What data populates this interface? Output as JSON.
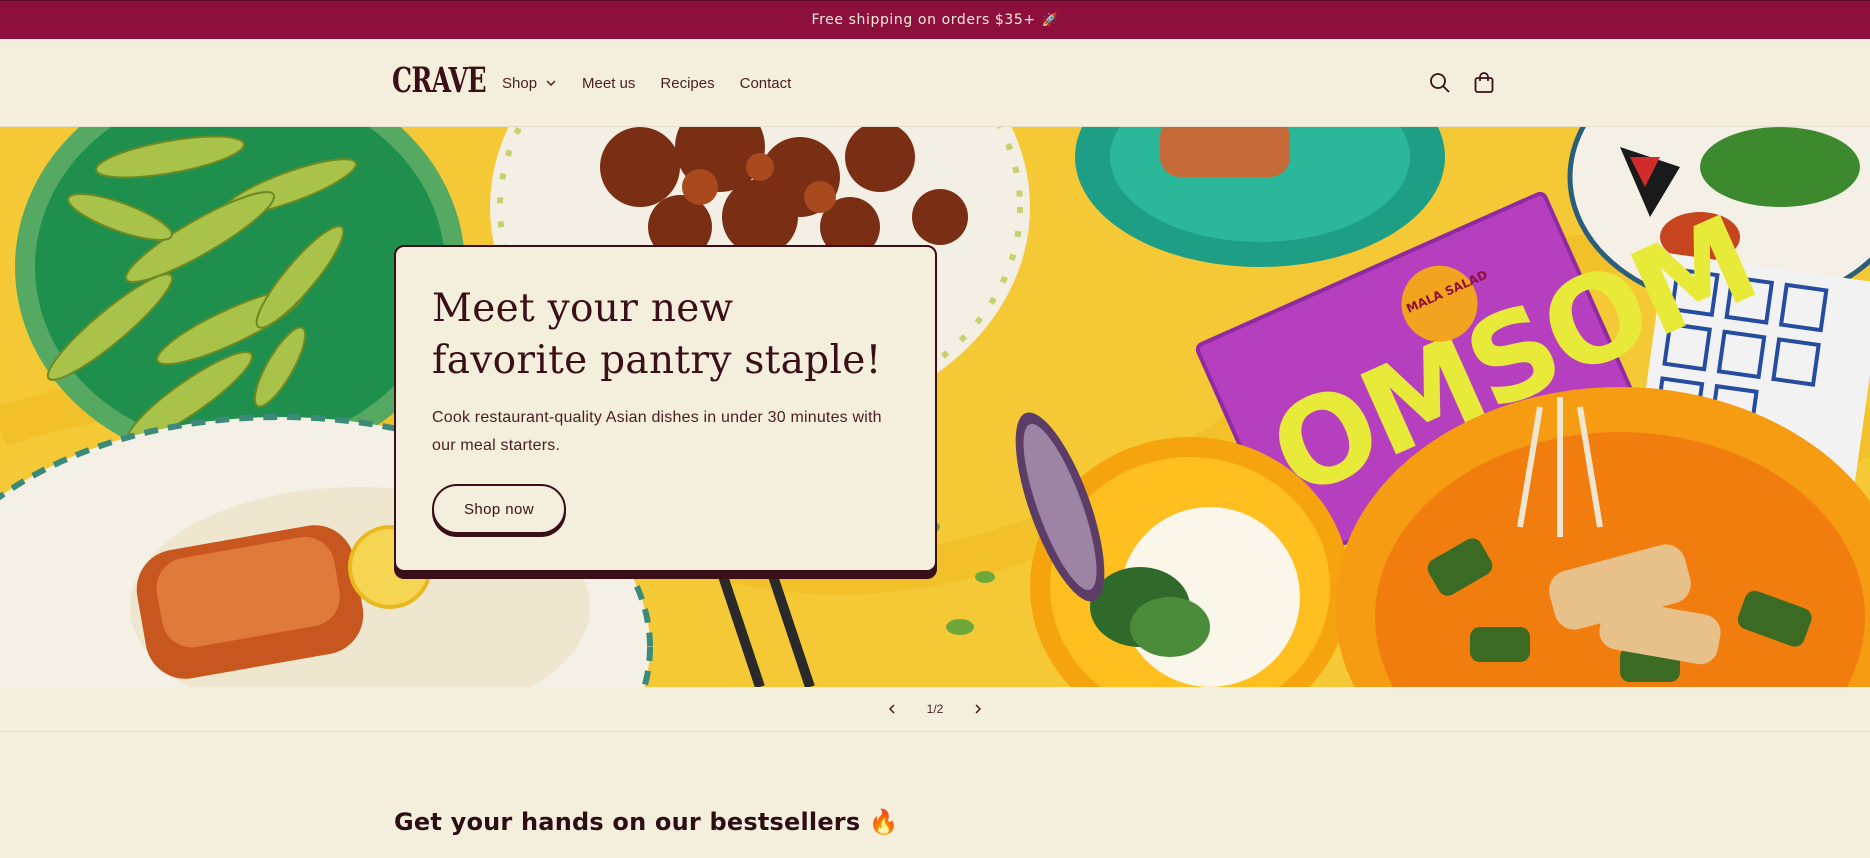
{
  "announcement": {
    "text": "Free shipping on orders $35+",
    "icon": "rocket-icon"
  },
  "header": {
    "logo": "CRAVE",
    "nav": [
      {
        "label": "Shop",
        "has_dropdown": true
      },
      {
        "label": "Meet us"
      },
      {
        "label": "Recipes"
      },
      {
        "label": "Contact"
      }
    ],
    "icons": [
      "search-icon",
      "cart-icon"
    ]
  },
  "hero": {
    "title": "Meet your new favorite pantry staple!",
    "subtitle": "Cook restaurant-quality Asian dishes in under 30 minutes with our meal starters.",
    "button_label": "Shop now",
    "package_brand": "OMSOM",
    "package_flavor": "MALA SALAD"
  },
  "slider": {
    "counter": "1/2",
    "prev_icon": "chevron-left-icon",
    "next_icon": "chevron-right-icon"
  },
  "bestsellers": {
    "title": "Get your hands on our bestsellers",
    "icon": "fire-icon"
  },
  "colors": {
    "announcement_bg": "#8c0f3e",
    "page_bg": "#f3efdc",
    "text_primary": "#3b0f18",
    "hero_bg": "#f5c935",
    "package": "#b63fc0"
  }
}
